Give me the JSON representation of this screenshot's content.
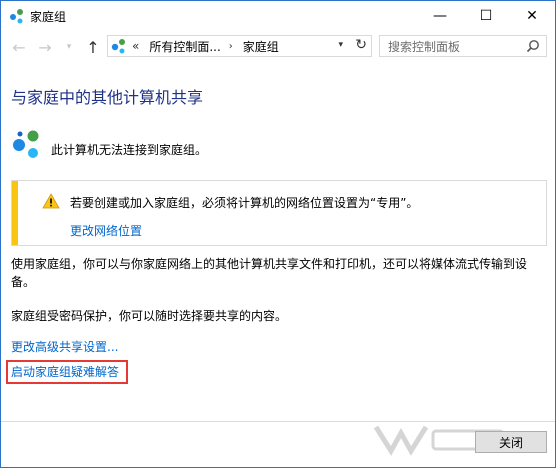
{
  "window": {
    "title": "家庭组",
    "min_glyph": "—",
    "max_glyph": "☐",
    "close_glyph": "✕"
  },
  "nav": {
    "back_glyph": "←",
    "forward_glyph": "→",
    "dropdown_glyph": "▾",
    "up_glyph": "↑"
  },
  "address": {
    "chevron": "«",
    "segments": [
      "所有控制面...",
      "家庭组"
    ],
    "separator": "›",
    "dropdown_glyph": "▾",
    "refresh_glyph": "↻"
  },
  "search": {
    "placeholder": "搜索控制面板"
  },
  "main": {
    "heading": "与家庭中的其他计算机共享",
    "status_text": "此计算机无法连接到家庭组。",
    "warning": {
      "text": "若要创建或加入家庭组，必须将计算机的网络位置设置为“专用”。",
      "link": "更改网络位置"
    },
    "paragraph1": "使用家庭组，你可以与你家庭网络上的其他计算机共享文件和打印机，还可以将媒体流式传输到设备。",
    "paragraph2": "家庭组受密码保护，你可以随时选择要共享的内容。",
    "link_advanced": "更改高级共享设置...",
    "link_troubleshoot": "启动家庭组疑难解答"
  },
  "footer": {
    "close_label": "关闭"
  },
  "colors": {
    "heading": "#1e3287",
    "link": "#0066cc",
    "warning_bar": "#f9c412",
    "highlight_border": "#e53935"
  }
}
